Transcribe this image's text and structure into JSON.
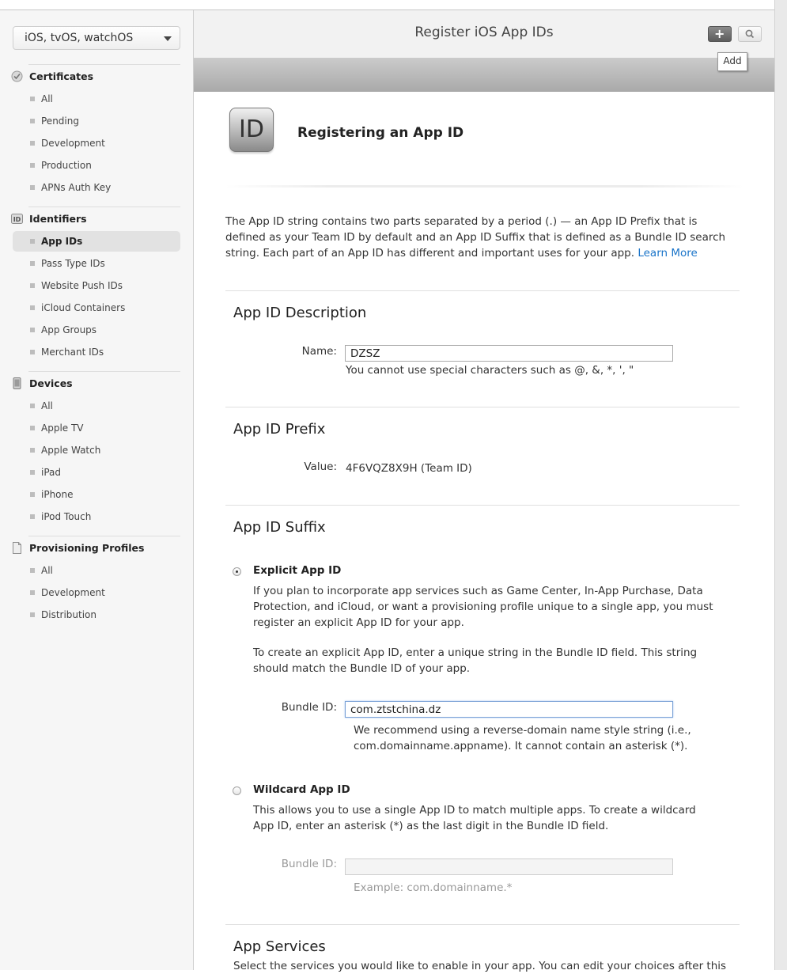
{
  "sidebar": {
    "platform": "iOS, tvOS, watchOS",
    "sections": [
      {
        "title": "Certificates",
        "items": [
          "All",
          "Pending",
          "Development",
          "Production",
          "APNs Auth Key"
        ]
      },
      {
        "title": "Identifiers",
        "items": [
          "App IDs",
          "Pass Type IDs",
          "Website Push IDs",
          "iCloud Containers",
          "App Groups",
          "Merchant IDs"
        ]
      },
      {
        "title": "Devices",
        "items": [
          "All",
          "Apple TV",
          "Apple Watch",
          "iPad",
          "iPhone",
          "iPod Touch"
        ]
      },
      {
        "title": "Provisioning Profiles",
        "items": [
          "All",
          "Development",
          "Distribution"
        ]
      }
    ],
    "active_item": "App IDs"
  },
  "header": {
    "title": "Register iOS App IDs",
    "tooltip": "Add"
  },
  "hero": {
    "icon_text": "ID",
    "title": "Registering an App ID"
  },
  "intro": {
    "text": "The App ID string contains two parts separated by a period (.) — an App ID Prefix that is defined as your Team ID by default and an App ID Suffix that is defined as a Bundle ID search string. Each part of an App ID has different and important uses for your app.",
    "link": "Learn More"
  },
  "description": {
    "heading": "App ID Description",
    "name_label": "Name:",
    "name_value": "DZSZ",
    "hint": "You cannot use special characters such as @, &, *, ', \""
  },
  "prefix": {
    "heading": "App ID Prefix",
    "value_label": "Value:",
    "value": "4F6VQZ8X9H (Team ID)"
  },
  "suffix": {
    "heading": "App ID Suffix",
    "explicit": {
      "title": "Explicit App ID",
      "selected": true,
      "para1": "If you plan to incorporate app services such as Game Center, In-App Purchase, Data Protection, and iCloud, or want a provisioning profile unique to a single app, you must register an explicit App ID for your app.",
      "para2": "To create an explicit App ID, enter a unique string in the Bundle ID field. This string should match the Bundle ID of your app.",
      "bundle_label": "Bundle ID:",
      "bundle_value": "com.ztstchina.dz",
      "bundle_hint": "We recommend using a reverse-domain name style string (i.e., com.domainname.appname). It cannot contain an asterisk (*)."
    },
    "wildcard": {
      "title": "Wildcard App ID",
      "selected": false,
      "para": "This allows you to use a single App ID to match multiple apps. To create a wildcard App ID, enter an asterisk (*) as the last digit in the Bundle ID field.",
      "bundle_label": "Bundle ID:",
      "bundle_value": "",
      "example": "Example: com.domainname.*"
    }
  },
  "services": {
    "heading": "App Services",
    "text": "Select the services you would like to enable in your app. You can edit your choices after this"
  }
}
